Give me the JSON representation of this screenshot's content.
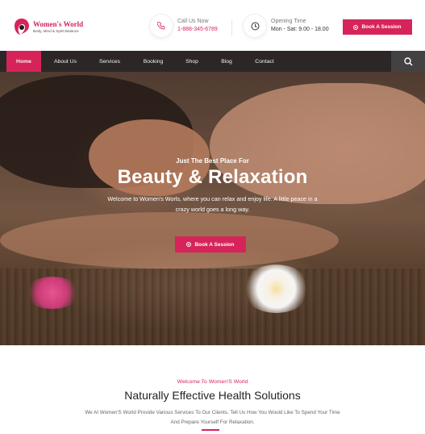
{
  "header": {
    "logo": {
      "title": "Women's World",
      "subtitle": "Body, Mind & Spirit Balance",
      "icon": "woman-face-logo-icon"
    },
    "call": {
      "label": "Call Us Now",
      "value": "1-888-345-6789",
      "icon": "phone-icon"
    },
    "hours": {
      "label": "Opening Time",
      "value": "Mon - Sat: 9.00 - 18.00",
      "icon": "clock-icon"
    },
    "cta": {
      "label": "Book A Session",
      "icon": "target-icon"
    }
  },
  "nav": {
    "items": [
      {
        "label": "Home",
        "active": true
      },
      {
        "label": "About Us",
        "active": false
      },
      {
        "label": "Services",
        "active": false
      },
      {
        "label": "Booking",
        "active": false
      },
      {
        "label": "Shop",
        "active": false
      },
      {
        "label": "Blog",
        "active": false
      },
      {
        "label": "Contact",
        "active": false
      }
    ],
    "search_icon": "search-icon"
  },
  "hero": {
    "kicker": "Just The Best Place For",
    "title": "Beauty & Relaxation",
    "description": "Welcome to Women's Worls, where you can relax and enjoy life. A little peace in a crazy world goes a long way.",
    "cta": {
      "label": "Book A Session",
      "icon": "target-icon"
    }
  },
  "section": {
    "kicker": "Welcome To Women'S World",
    "title": "Naturally Effective Health Solutions",
    "text": "We At Women'S World Provide Various Services To Our Clients. Tell Us How You Would Like To Spend Your Time And Prepare Yourself For Relaxation."
  },
  "colors": {
    "accent": "#d6245a",
    "nav_bg": "#2b2729",
    "text_dark": "#222222"
  }
}
